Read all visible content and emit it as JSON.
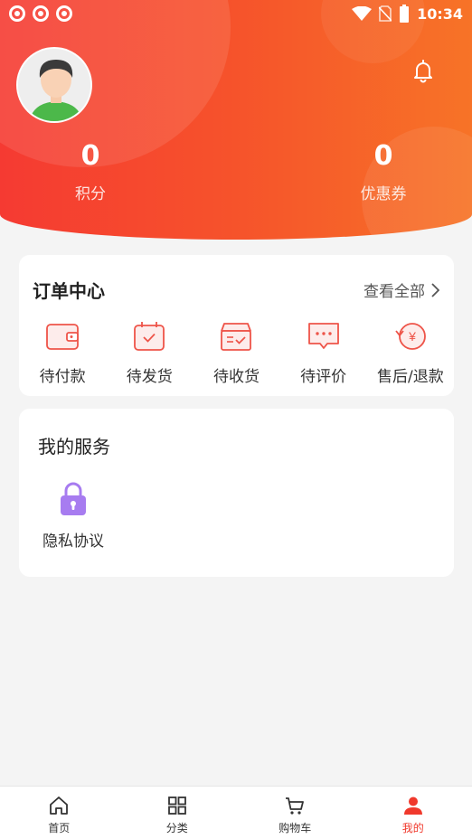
{
  "status_bar": {
    "time": "10:34"
  },
  "profile": {
    "points_value": "0",
    "points_label": "积分",
    "coupons_value": "0",
    "coupons_label": "优惠券"
  },
  "orders": {
    "title": "订单中心",
    "view_all": "查看全部",
    "items": [
      {
        "label": "待付款",
        "icon": "wallet-icon"
      },
      {
        "label": "待发货",
        "icon": "calendar-check-icon"
      },
      {
        "label": "待收货",
        "icon": "box-icon"
      },
      {
        "label": "待评价",
        "icon": "comment-icon"
      },
      {
        "label": "售后/退款",
        "icon": "refund-icon"
      }
    ]
  },
  "services": {
    "title": "我的服务",
    "items": [
      {
        "label": "隐私协议",
        "icon": "lock-icon"
      }
    ]
  },
  "tabbar": {
    "items": [
      {
        "label": "首页",
        "icon": "home-icon"
      },
      {
        "label": "分类",
        "icon": "grid-icon"
      },
      {
        "label": "购物车",
        "icon": "cart-icon"
      },
      {
        "label": "我的",
        "icon": "user-icon",
        "active": true
      }
    ]
  },
  "colors": {
    "primary": "#f0392c",
    "header_start": "#f53a32",
    "header_end": "#f77327",
    "service_icon": "#a77cf0"
  }
}
